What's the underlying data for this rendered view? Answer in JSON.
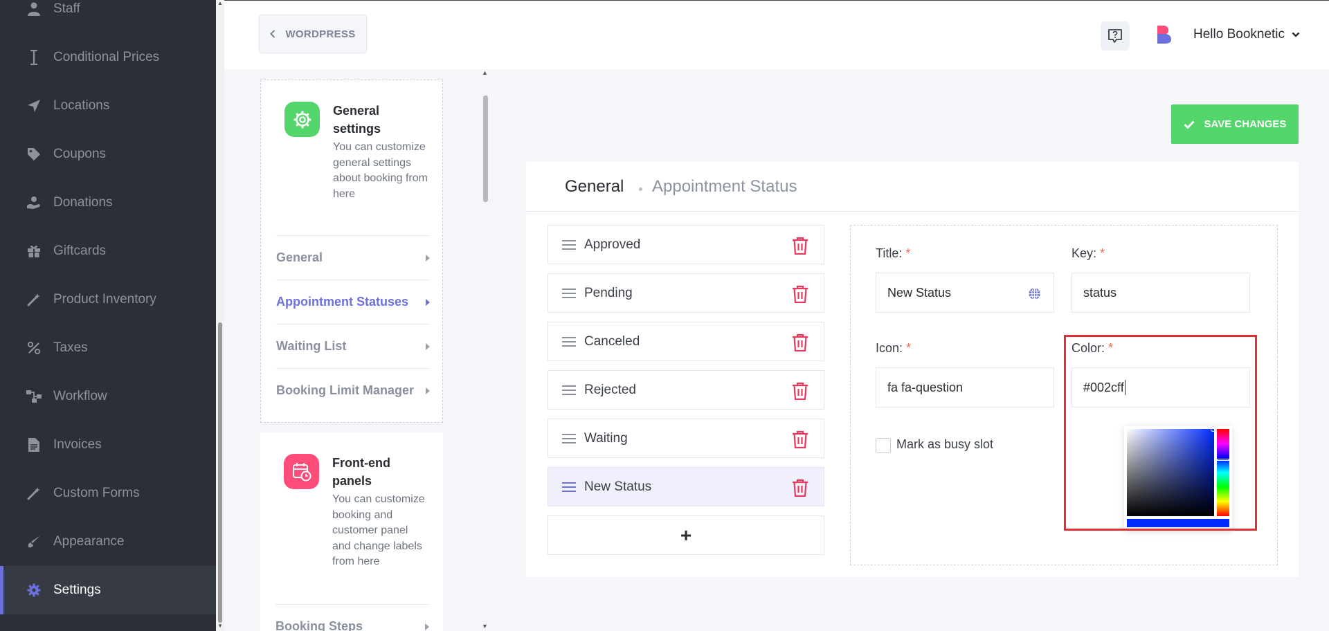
{
  "sidebar": {
    "items": [
      {
        "label": "Staff",
        "icon": "user-icon"
      },
      {
        "label": "Conditional Prices",
        "icon": "cursor-icon"
      },
      {
        "label": "Locations",
        "icon": "location-arrow-icon"
      },
      {
        "label": "Coupons",
        "icon": "tag-icon"
      },
      {
        "label": "Donations",
        "icon": "donate-icon"
      },
      {
        "label": "Giftcards",
        "icon": "gift-icon"
      },
      {
        "label": "Product Inventory",
        "icon": "magic-wand-icon"
      },
      {
        "label": "Taxes",
        "icon": "percent-icon"
      },
      {
        "label": "Workflow",
        "icon": "workflow-icon"
      },
      {
        "label": "Invoices",
        "icon": "invoice-icon"
      },
      {
        "label": "Custom Forms",
        "icon": "magic-wand-icon"
      },
      {
        "label": "Appearance",
        "icon": "brush-icon"
      },
      {
        "label": "Settings",
        "icon": "gear-icon",
        "active": true
      }
    ]
  },
  "topbar": {
    "back_label": "WORDPRESS",
    "user_greeting": "Hello Booknetic"
  },
  "settings_nav": {
    "general_card": {
      "title": "General settings",
      "description": "You can customize general settings about booking from here",
      "links": [
        "General",
        "Appointment Statuses",
        "Waiting List",
        "Booking Limit Manager"
      ],
      "active_link": "Appointment Statuses"
    },
    "frontend_card": {
      "title": "Front-end panels",
      "description": "You can customize booking and customer panel and change labels from here",
      "links": [
        "Booking Steps"
      ]
    }
  },
  "save_button": {
    "label": "SAVE CHANGES"
  },
  "breadcrumb": {
    "main": "General",
    "sub": "Appointment Status"
  },
  "statuses": [
    "Approved",
    "Pending",
    "Canceled",
    "Rejected",
    "Waiting",
    "New Status"
  ],
  "selected_status": "New Status",
  "add_label": "+",
  "form": {
    "title_label": "Title:",
    "title_value": "New Status",
    "key_label": "Key:",
    "key_value": "status",
    "icon_label": "Icon:",
    "icon_value": "fa fa-question",
    "color_label": "Color:",
    "color_value": "#002cff",
    "required_mark": "*",
    "busy_slot_label": "Mark as busy slot",
    "busy_slot_checked": false
  },
  "colors": {
    "sidebar_bg": "#2c3036",
    "accent": "#6c70dc",
    "save_green": "#53d56c",
    "trash_red": "#e8395d",
    "picked_color": "#002cff",
    "highlight_red": "#e03030"
  }
}
